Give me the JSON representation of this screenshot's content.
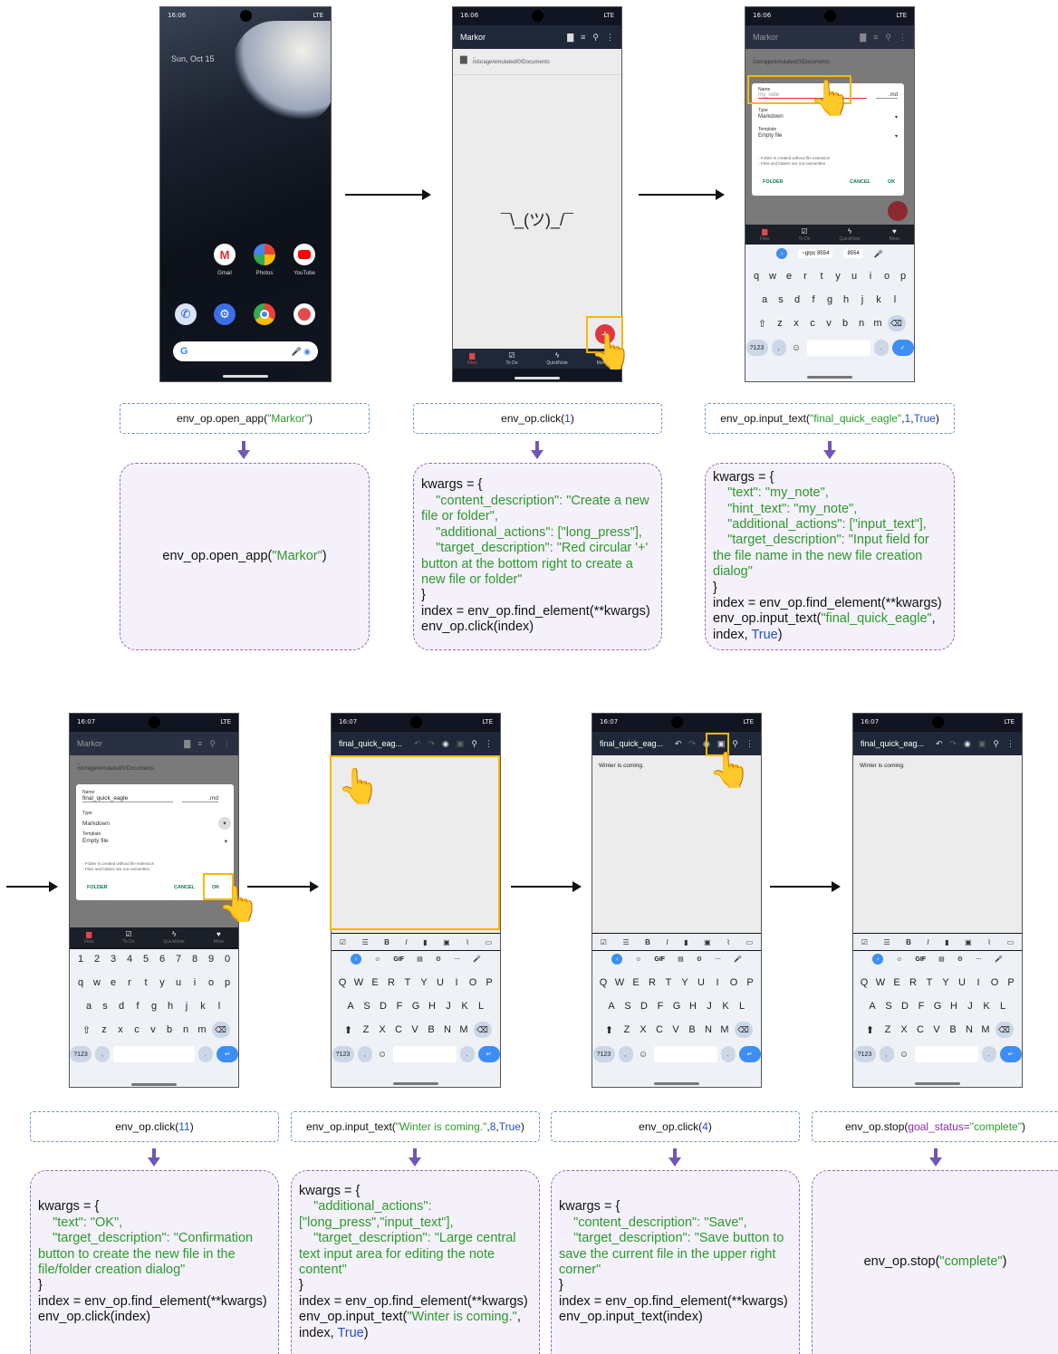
{
  "status": {
    "time_1": "16:06",
    "time_2": "16:07",
    "signal": "LTE"
  },
  "home": {
    "date": "Sun, Oct 15",
    "apps": [
      "Gmail",
      "Photos",
      "YouTube"
    ],
    "search_g": "G"
  },
  "markor": {
    "title": "Markor",
    "folder_up": "..",
    "folder_path": "/storage/emulated/0/Documents",
    "shrug": "¯\\_(ツ)_/¯",
    "fab": "+",
    "nav": [
      "Files",
      "To Do",
      "QuickNote",
      "More"
    ]
  },
  "dialog": {
    "name_label": "Name",
    "name_hint": "my_note",
    "name_value": "final_quick_eagle",
    "ext": ".md",
    "type_label": "Type",
    "type_value": "Markdown",
    "template_label": "Template",
    "template_value": "Empty file",
    "note1": "- Folder is created without file extension",
    "note2": "- Files and folders are not overwritten",
    "folder_btn": "FOLDER",
    "cancel_btn": "CANCEL",
    "ok_btn": "OK"
  },
  "editor": {
    "title": "final_quick_eag...",
    "content": "Winter is coming."
  },
  "keyboard": {
    "suggest1": "~grpc 8554",
    "suggest2": "8554",
    "row1_lower": [
      "q",
      "w",
      "e",
      "r",
      "t",
      "y",
      "u",
      "i",
      "o",
      "p"
    ],
    "row2_lower": [
      "a",
      "s",
      "d",
      "f",
      "g",
      "h",
      "j",
      "k",
      "l"
    ],
    "row3_lower": [
      "z",
      "x",
      "c",
      "v",
      "b",
      "n",
      "m"
    ],
    "row1_upper": [
      "Q",
      "W",
      "E",
      "R",
      "T",
      "Y",
      "U",
      "I",
      "O",
      "P"
    ],
    "row2_upper": [
      "A",
      "S",
      "D",
      "F",
      "G",
      "H",
      "J",
      "K",
      "L"
    ],
    "row3_upper": [
      "Z",
      "X",
      "C",
      "V",
      "B",
      "N",
      "M"
    ],
    "digits": [
      "1",
      "2",
      "3",
      "4",
      "5",
      "6",
      "7",
      "8",
      "9",
      "0"
    ],
    "sym": "?123",
    "comma": ",",
    "period": ".",
    "gif": "GIF"
  },
  "steps": {
    "s1_cmd_a": "env_op.open_app(",
    "s1_cmd_b": "\"Markor\"",
    "s1_cmd_c": ")",
    "s2_cmd_a": "env_op.click(",
    "s2_cmd_b": "1",
    "s2_cmd_c": ")",
    "s3_cmd_a": "env_op.input_text(",
    "s3_cmd_b": "\"final_quick_eagle\"",
    "s3_cmd_c": ", ",
    "s3_cmd_d": "1",
    "s3_cmd_e": ", ",
    "s3_cmd_f": "True",
    "s3_cmd_g": ")",
    "s4_cmd_a": "env_op.click(",
    "s4_cmd_b": "11",
    "s4_cmd_c": ")",
    "s5_cmd_a": "env_op.input_text(",
    "s5_cmd_b": "\"Winter is coming.\"",
    "s5_cmd_c": ", ",
    "s5_cmd_d": "8",
    "s5_cmd_e": ", ",
    "s5_cmd_f": "True",
    "s5_cmd_g": ")",
    "s6_cmd_a": "env_op.click(",
    "s6_cmd_b": "4",
    "s6_cmd_c": ")",
    "s7_cmd_a": "env_op.stop(",
    "s7_cmd_b": "goal_status=",
    "s7_cmd_c": "\"complete\"",
    "s7_cmd_d": ")"
  },
  "code": {
    "c1_a": "env_op.open_app(",
    "c1_b": "\"Markor\"",
    "c1_c": ")",
    "c2_l1": "kwargs = {",
    "c2_l2": "    \"content_description\": \"Create a new file or folder\",",
    "c2_l3": "    \"additional_actions\": [\"long_press\"],",
    "c2_l4": "    \"target_description\": \"Red circular '+' button at the bottom right to create a new file or folder\"",
    "c2_l5": "}",
    "c2_l6": "index = env_op.find_element(**kwargs)",
    "c2_l7": "env_op.click(index)",
    "c3_l1": "kwargs = {",
    "c3_l2": "    \"text\": \"my_note\",",
    "c3_l3": "    \"hint_text\": \"my_note\",",
    "c3_l4": "    \"additional_actions\": [\"input_text\"],",
    "c3_l5": "    \"target_description\": \"Input field for the file name in the new file creation dialog\"",
    "c3_l6": "}",
    "c3_l7": "index = env_op.find_element(**kwargs)",
    "c3_l8a": "env_op.input_text(",
    "c3_l8b": "\"final_quick_eagle\"",
    "c3_l8c": ", index, ",
    "c3_l8d": "True",
    "c3_l8e": ")",
    "c4_l1": "kwargs = {",
    "c4_l2": "    \"text\": \"OK\",",
    "c4_l3": "    \"target_description\": \"Confirmation button to create the new file in the file/folder creation dialog\"",
    "c4_l4": "}",
    "c4_l5": "index = env_op.find_element(**kwargs)",
    "c4_l6": "env_op.click(index)",
    "c5_l1": "kwargs = {",
    "c5_l2": "    \"additional_actions\": [\"long_press\",\"input_text\"],",
    "c5_l3": "    \"target_description\": \"Large central text input area for editing the note content\"",
    "c5_l4": "}",
    "c5_l5": "index = env_op.find_element(**kwargs)",
    "c5_l6a": "env_op.input_text(",
    "c5_l6b": "\"Winter is coming.\"",
    "c5_l6c": ", index, ",
    "c5_l6d": "True",
    "c5_l6e": ")",
    "c6_l1": "kwargs = {",
    "c6_l2": "    \"content_description\": \"Save\",",
    "c6_l3": "    \"target_description\": \"Save button to save the current file in the upper right corner\"",
    "c6_l4": "}",
    "c6_l5": "index = env_op.find_element(**kwargs)",
    "c6_l6": "env_op.input_text(index)",
    "c7_a": "env_op.stop(",
    "c7_b": "\"complete\"",
    "c7_c": ")"
  }
}
